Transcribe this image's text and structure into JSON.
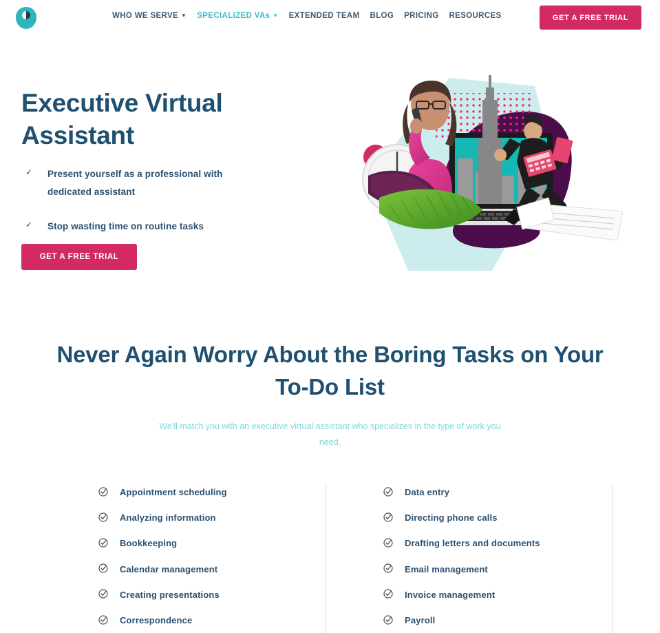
{
  "brand": {
    "logo_icon": "teal-blob-logo",
    "accent_pink": "#d42a62",
    "accent_teal": "#3fbdc4",
    "heading_navy": "#1f5070",
    "subtitle_teal": "#7fd4dd"
  },
  "header": {
    "nav": [
      {
        "label": "WHO WE SERVE",
        "caret": "▼",
        "active": false
      },
      {
        "label": "SPECIALIZED VAs",
        "caret": "▼",
        "active": true
      },
      {
        "label": "EXTENDED TEAM",
        "caret": "",
        "active": false
      },
      {
        "label": "BLOG",
        "caret": "",
        "active": false
      },
      {
        "label": "PRICING",
        "caret": "",
        "active": false
      },
      {
        "label": "RESOURCES",
        "caret": "",
        "active": false
      }
    ],
    "cta_label": "GET A FREE TRIAL"
  },
  "hero": {
    "title": "Executive Virtual Assistant",
    "check_glyph": "✓",
    "bullets": [
      "Present yourself as a professional with dedicated assistant",
      "Stop wasting time on routine tasks"
    ],
    "cta_label": "GET A FREE TRIAL",
    "illustration_name": "virtual-assistant-collage"
  },
  "section": {
    "heading": "Never Again Worry About the Boring Tasks on Your To-Do List",
    "subtitle": "We'll match you with an executive virtual assistant who specializes in the type of work you need.",
    "task_icon_glyph": "✓",
    "tasks_left": [
      "Appointment scheduling",
      "Analyzing information",
      "Bookkeeping",
      "Calendar management",
      "Creating presentations",
      "Correspondence"
    ],
    "tasks_right": [
      "Data entry",
      "Directing phone calls",
      "Drafting letters and documents",
      "Email management",
      "Invoice management",
      "Payroll"
    ]
  }
}
